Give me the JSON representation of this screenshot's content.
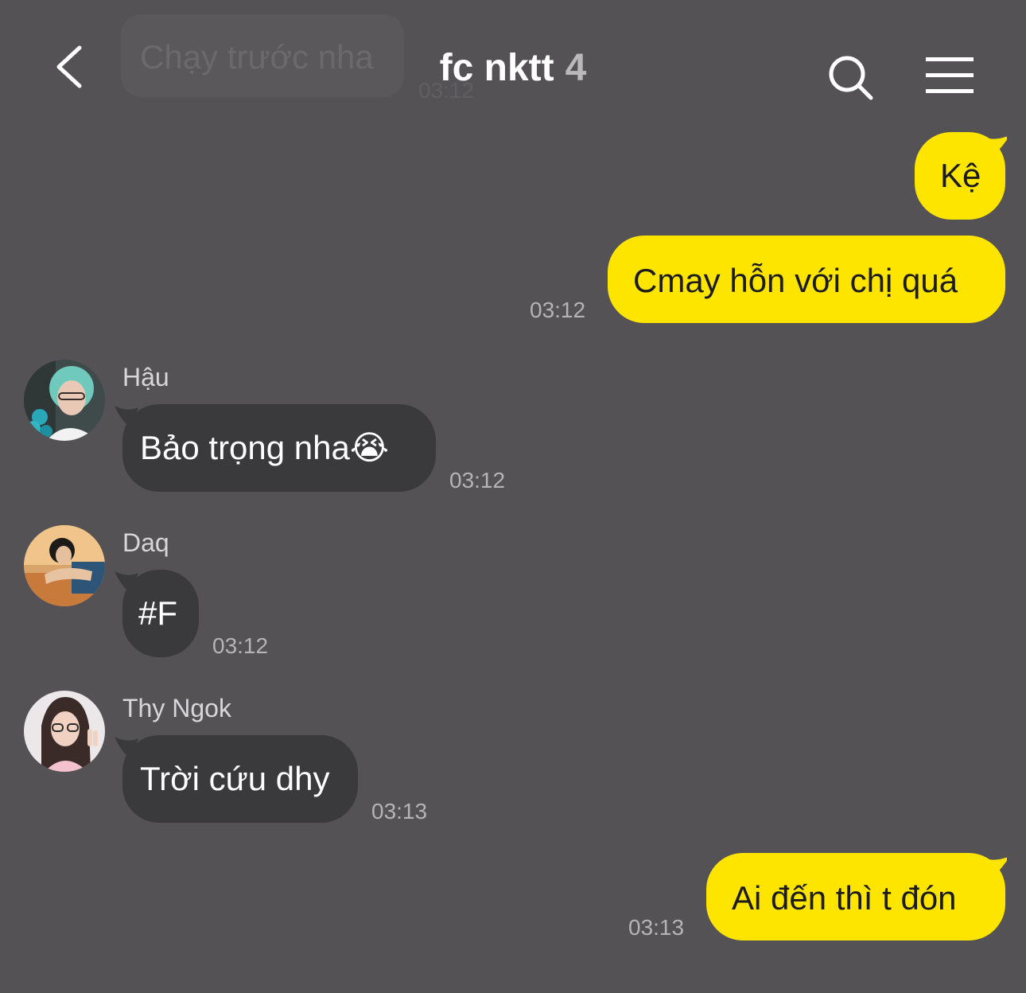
{
  "header": {
    "title": "fc nktt",
    "member_count": "4",
    "ghost_message": "Chạy trước nha",
    "ghost_time": "03:12"
  },
  "messages": [
    {
      "sender": "",
      "text": "Kệ",
      "time": "",
      "mine": true
    },
    {
      "sender": "",
      "text": "Cmay hỗn với chị quá",
      "time": "03:12",
      "mine": true
    },
    {
      "sender": "Hậu",
      "text": "Bảo trọng nha😭",
      "time": "03:12",
      "mine": false
    },
    {
      "sender": "Daq",
      "text": "#F",
      "time": "03:12",
      "mine": false
    },
    {
      "sender": "Thy Ngok",
      "text": "Trời cứu dhy",
      "time": "03:13",
      "mine": false
    },
    {
      "sender": "",
      "text": "Ai đến thì t đón",
      "time": "03:13",
      "mine": true
    }
  ],
  "icons": {
    "back": "back-chevron-icon",
    "search": "search-icon",
    "menu": "hamburger-menu-icon"
  },
  "colors": {
    "background": "#545255",
    "my_bubble": "#fee500",
    "their_bubble": "#3a393c"
  }
}
